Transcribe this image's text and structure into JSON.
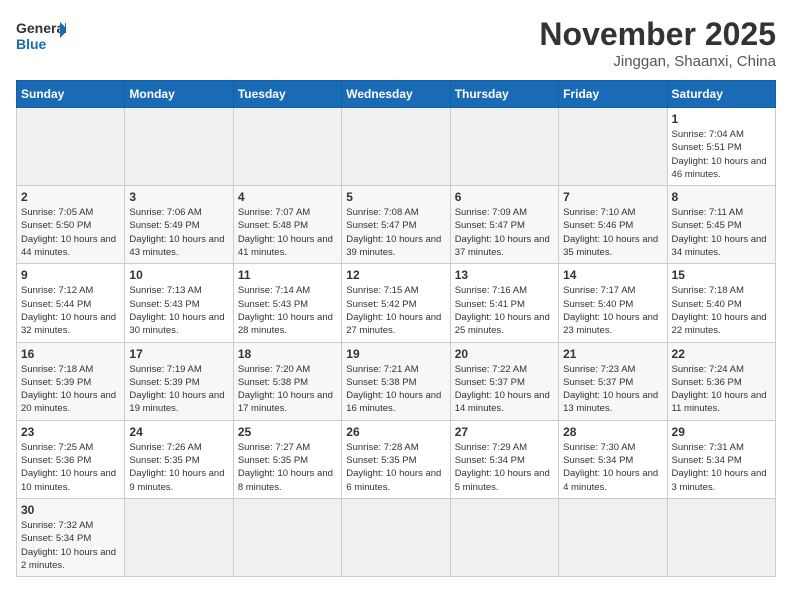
{
  "header": {
    "logo_general": "General",
    "logo_blue": "Blue",
    "title": "November 2025",
    "subtitle": "Jinggan, Shaanxi, China"
  },
  "weekdays": [
    "Sunday",
    "Monday",
    "Tuesday",
    "Wednesday",
    "Thursday",
    "Friday",
    "Saturday"
  ],
  "weeks": [
    [
      {
        "day": "",
        "info": ""
      },
      {
        "day": "",
        "info": ""
      },
      {
        "day": "",
        "info": ""
      },
      {
        "day": "",
        "info": ""
      },
      {
        "day": "",
        "info": ""
      },
      {
        "day": "",
        "info": ""
      },
      {
        "day": "1",
        "info": "Sunrise: 7:04 AM\nSunset: 5:51 PM\nDaylight: 10 hours and 46 minutes."
      }
    ],
    [
      {
        "day": "2",
        "info": "Sunrise: 7:05 AM\nSunset: 5:50 PM\nDaylight: 10 hours and 44 minutes."
      },
      {
        "day": "3",
        "info": "Sunrise: 7:06 AM\nSunset: 5:49 PM\nDaylight: 10 hours and 43 minutes."
      },
      {
        "day": "4",
        "info": "Sunrise: 7:07 AM\nSunset: 5:48 PM\nDaylight: 10 hours and 41 minutes."
      },
      {
        "day": "5",
        "info": "Sunrise: 7:08 AM\nSunset: 5:47 PM\nDaylight: 10 hours and 39 minutes."
      },
      {
        "day": "6",
        "info": "Sunrise: 7:09 AM\nSunset: 5:47 PM\nDaylight: 10 hours and 37 minutes."
      },
      {
        "day": "7",
        "info": "Sunrise: 7:10 AM\nSunset: 5:46 PM\nDaylight: 10 hours and 35 minutes."
      },
      {
        "day": "8",
        "info": "Sunrise: 7:11 AM\nSunset: 5:45 PM\nDaylight: 10 hours and 34 minutes."
      }
    ],
    [
      {
        "day": "9",
        "info": "Sunrise: 7:12 AM\nSunset: 5:44 PM\nDaylight: 10 hours and 32 minutes."
      },
      {
        "day": "10",
        "info": "Sunrise: 7:13 AM\nSunset: 5:43 PM\nDaylight: 10 hours and 30 minutes."
      },
      {
        "day": "11",
        "info": "Sunrise: 7:14 AM\nSunset: 5:43 PM\nDaylight: 10 hours and 28 minutes."
      },
      {
        "day": "12",
        "info": "Sunrise: 7:15 AM\nSunset: 5:42 PM\nDaylight: 10 hours and 27 minutes."
      },
      {
        "day": "13",
        "info": "Sunrise: 7:16 AM\nSunset: 5:41 PM\nDaylight: 10 hours and 25 minutes."
      },
      {
        "day": "14",
        "info": "Sunrise: 7:17 AM\nSunset: 5:40 PM\nDaylight: 10 hours and 23 minutes."
      },
      {
        "day": "15",
        "info": "Sunrise: 7:18 AM\nSunset: 5:40 PM\nDaylight: 10 hours and 22 minutes."
      }
    ],
    [
      {
        "day": "16",
        "info": "Sunrise: 7:18 AM\nSunset: 5:39 PM\nDaylight: 10 hours and 20 minutes."
      },
      {
        "day": "17",
        "info": "Sunrise: 7:19 AM\nSunset: 5:39 PM\nDaylight: 10 hours and 19 minutes."
      },
      {
        "day": "18",
        "info": "Sunrise: 7:20 AM\nSunset: 5:38 PM\nDaylight: 10 hours and 17 minutes."
      },
      {
        "day": "19",
        "info": "Sunrise: 7:21 AM\nSunset: 5:38 PM\nDaylight: 10 hours and 16 minutes."
      },
      {
        "day": "20",
        "info": "Sunrise: 7:22 AM\nSunset: 5:37 PM\nDaylight: 10 hours and 14 minutes."
      },
      {
        "day": "21",
        "info": "Sunrise: 7:23 AM\nSunset: 5:37 PM\nDaylight: 10 hours and 13 minutes."
      },
      {
        "day": "22",
        "info": "Sunrise: 7:24 AM\nSunset: 5:36 PM\nDaylight: 10 hours and 11 minutes."
      }
    ],
    [
      {
        "day": "23",
        "info": "Sunrise: 7:25 AM\nSunset: 5:36 PM\nDaylight: 10 hours and 10 minutes."
      },
      {
        "day": "24",
        "info": "Sunrise: 7:26 AM\nSunset: 5:35 PM\nDaylight: 10 hours and 9 minutes."
      },
      {
        "day": "25",
        "info": "Sunrise: 7:27 AM\nSunset: 5:35 PM\nDaylight: 10 hours and 8 minutes."
      },
      {
        "day": "26",
        "info": "Sunrise: 7:28 AM\nSunset: 5:35 PM\nDaylight: 10 hours and 6 minutes."
      },
      {
        "day": "27",
        "info": "Sunrise: 7:29 AM\nSunset: 5:34 PM\nDaylight: 10 hours and 5 minutes."
      },
      {
        "day": "28",
        "info": "Sunrise: 7:30 AM\nSunset: 5:34 PM\nDaylight: 10 hours and 4 minutes."
      },
      {
        "day": "29",
        "info": "Sunrise: 7:31 AM\nSunset: 5:34 PM\nDaylight: 10 hours and 3 minutes."
      }
    ],
    [
      {
        "day": "30",
        "info": "Sunrise: 7:32 AM\nSunset: 5:34 PM\nDaylight: 10 hours and 2 minutes."
      },
      {
        "day": "",
        "info": ""
      },
      {
        "day": "",
        "info": ""
      },
      {
        "day": "",
        "info": ""
      },
      {
        "day": "",
        "info": ""
      },
      {
        "day": "",
        "info": ""
      },
      {
        "day": "",
        "info": ""
      }
    ]
  ]
}
